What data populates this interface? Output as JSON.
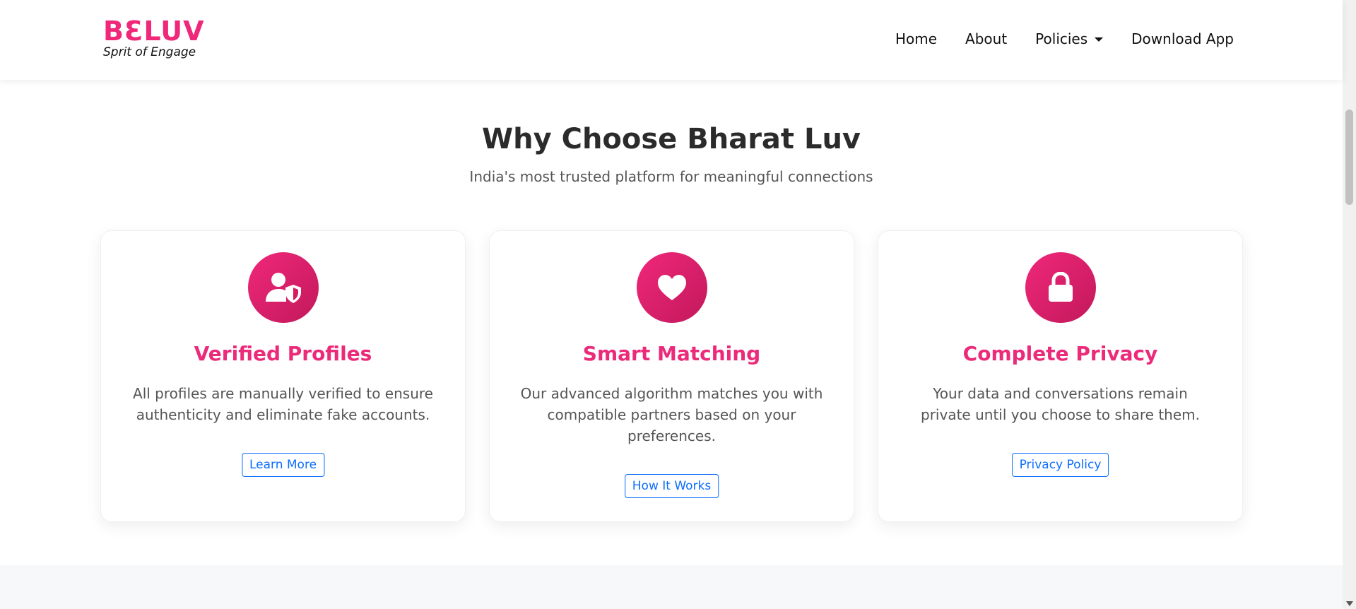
{
  "nav": {
    "brand_name": "BƐLUV",
    "brand_tagline": "Sprit of Engage",
    "links": [
      {
        "label": "Home"
      },
      {
        "label": "About"
      },
      {
        "label": "Policies"
      },
      {
        "label": "Download App"
      }
    ]
  },
  "section": {
    "title": "Why Choose Bharat Luv",
    "subtitle": "India's most trusted platform for meaningful connections"
  },
  "cards": [
    {
      "icon": "user-shield-icon",
      "title": "Verified Profiles",
      "text": "All profiles are manually verified to ensure authenticity and eliminate fake accounts.",
      "button": "Learn More"
    },
    {
      "icon": "heart-icon",
      "title": "Smart Matching",
      "text": "Our advanced algorithm matches you with compatible partners based on your preferences.",
      "button": "How It Works"
    },
    {
      "icon": "lock-icon",
      "title": "Complete Privacy",
      "text": "Your data and conversations remain private until you choose to share them.",
      "button": "Privacy Policy"
    }
  ],
  "colors": {
    "accent": "#f0287a",
    "accent_dark": "#c2185b",
    "button_blue": "#0d6efd"
  }
}
